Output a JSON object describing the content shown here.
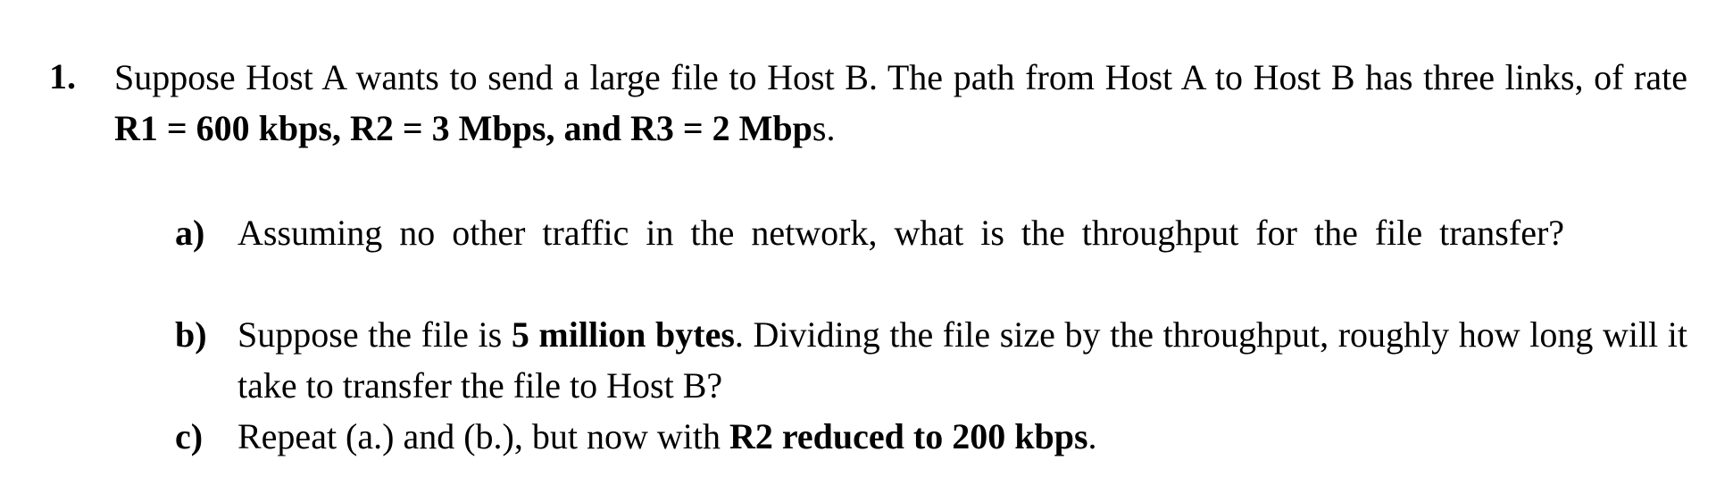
{
  "question": {
    "number": "1.",
    "text_1": "Suppose Host A wants to send a large file to Host B. The path from Host A to Host B has three links, of rate ",
    "bold_1": "R1 = 600 kbps, R2 = 3 Mbps, and R3 = 2 Mbp",
    "text_2": "s."
  },
  "parts": {
    "a": {
      "label": "a)",
      "text": "Assuming no other traffic in the network, what is the throughput for the file transfer?"
    },
    "b": {
      "label": "b)",
      "text_1": "Suppose the file is ",
      "bold_1": "5 million bytes",
      "text_2": ". Dividing the file size by the throughput, roughly how long will it take to transfer the file to Host B?"
    },
    "c": {
      "label": "c)",
      "text_1": "Repeat (a.) and (b.), but now with ",
      "bold_1": "R2 reduced to 200 kbps",
      "text_2": "."
    }
  }
}
